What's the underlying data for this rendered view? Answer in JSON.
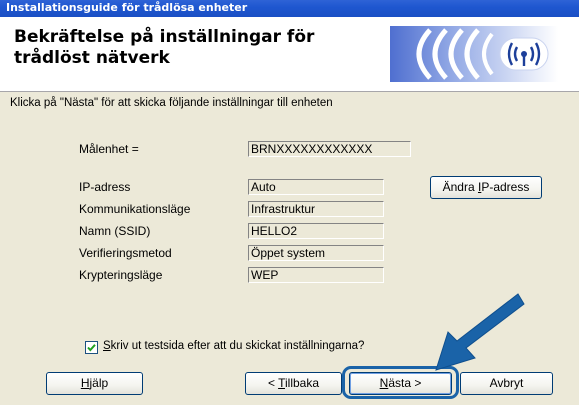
{
  "window": {
    "title": "Installationsguide för trådlösa enheter"
  },
  "header": {
    "title": "Bekräftelse på inställningar för trådlöst nätverk",
    "graphic_icon": "wireless-signal-icon"
  },
  "instruction": "Klicka på \"Nästa\" för att skicka följande inställningar till enheten",
  "target_device": {
    "label": "Målenhet =",
    "value": "BRNXXXXXXXXXXXX"
  },
  "settings": [
    {
      "label": "IP-adress",
      "value": "Auto"
    },
    {
      "label": "Kommunikationsläge",
      "value": "Infrastruktur"
    },
    {
      "label": "Namn (SSID)",
      "value": "HELLO2"
    },
    {
      "label": "Verifieringsmetod",
      "value": "Öppet system"
    },
    {
      "label": "Krypteringsläge",
      "value": "WEP"
    }
  ],
  "change_ip_button": {
    "label_prefix": "Ändra ",
    "label_underlined": "I",
    "label_suffix": "P-adress"
  },
  "print_test_page": {
    "checked": true,
    "label_underlined": "S",
    "label_rest": "kriv ut testsida efter att du skickat inställningarna?"
  },
  "buttons": {
    "help": {
      "underlined": "H",
      "rest": "jälp"
    },
    "back": {
      "prefix": "< ",
      "underlined": "T",
      "rest": "illbaka"
    },
    "next": {
      "underlined": "N",
      "rest": "ästa >"
    },
    "cancel": "Avbryt"
  },
  "annotation": {
    "arrow_icon": "pointer-arrow-icon",
    "arrow_color": "#1a63a8"
  }
}
